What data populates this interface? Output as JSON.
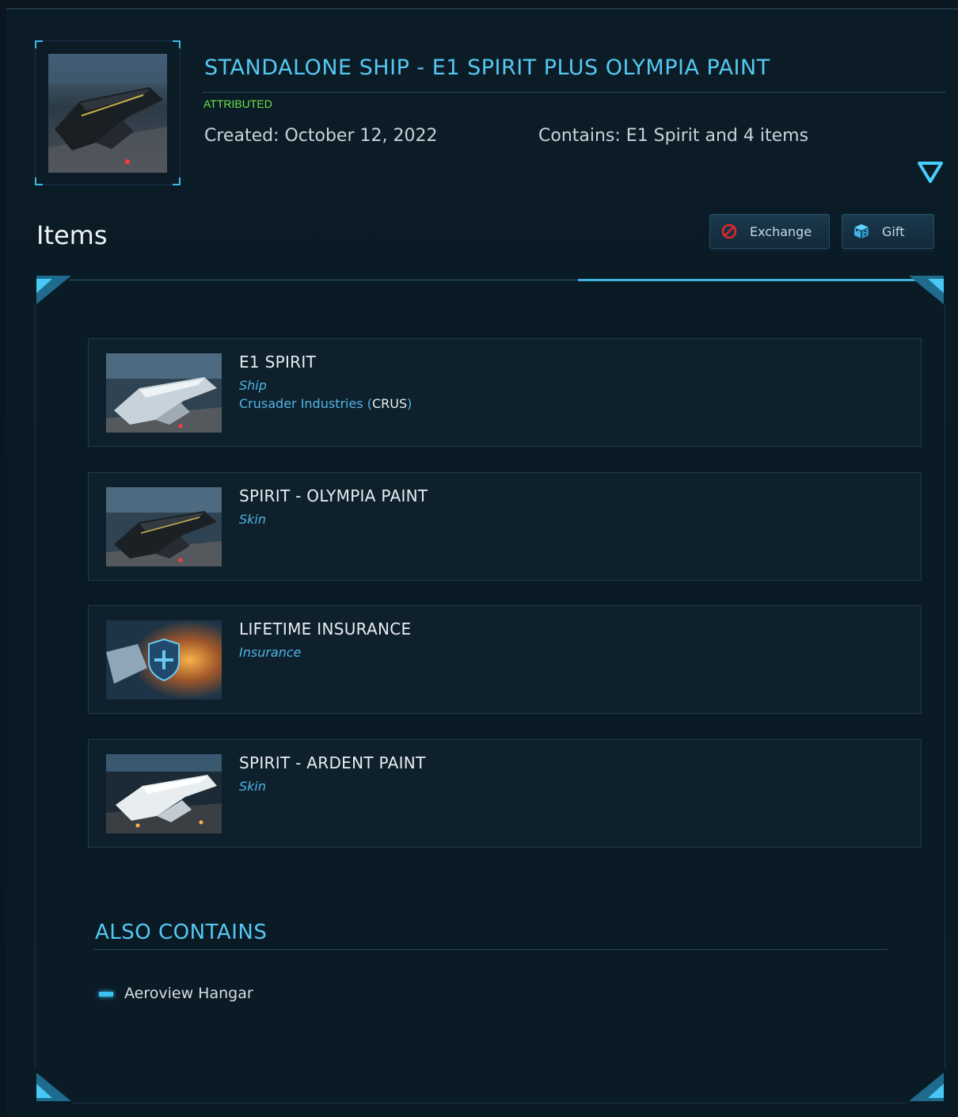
{
  "package": {
    "title": "STANDALONE SHIP - E1 SPIRIT PLUS OLYMPIA PAINT",
    "status": "ATTRIBUTED",
    "created": "Created: October 12, 2022",
    "contains": "Contains: E1 Spirit and 4 items",
    "status_color": "#6ee34a",
    "accent_color": "#55c8f2"
  },
  "items_section": {
    "heading": "Items",
    "buttons": {
      "exchange_label": "Exchange",
      "exchange_icon": "no-entry-icon",
      "gift_label": "Gift",
      "gift_icon": "gift-box-icon"
    },
    "items": [
      {
        "name": "E1 SPIRIT",
        "type": "Ship",
        "manufacturer": "Crusader Industries (",
        "manufacturer_code": "CRUS",
        "manufacturer_close": ")"
      },
      {
        "name": "SPIRIT - OLYMPIA PAINT",
        "type": "Skin"
      },
      {
        "name": "LIFETIME INSURANCE",
        "type": "Insurance"
      },
      {
        "name": "SPIRIT - ARDENT PAINT",
        "type": "Skin"
      }
    ]
  },
  "also_contains": {
    "title": "ALSO CONTAINS",
    "items": [
      "Aeroview Hangar"
    ]
  }
}
